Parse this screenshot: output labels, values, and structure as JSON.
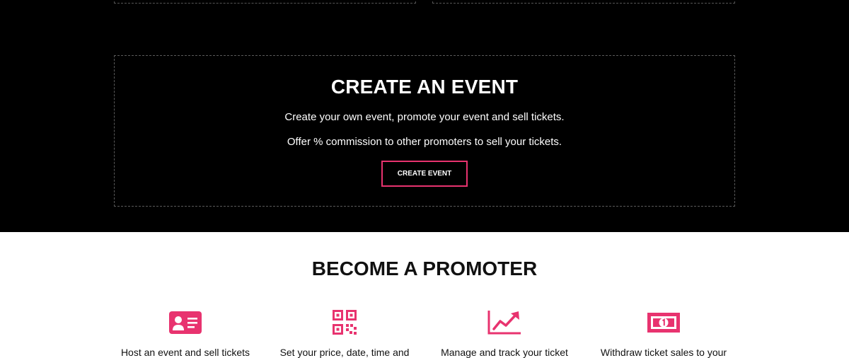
{
  "create_event": {
    "title": "CREATE AN EVENT",
    "line1": "Create your own event, promote your event and sell tickets.",
    "line2": "Offer % commission to other promoters to sell your tickets.",
    "button_label": "CREATE EVENT"
  },
  "promoter": {
    "title": "BECOME A PROMOTER",
    "features": [
      {
        "icon": "id-card-icon",
        "label": "Host an event and sell tickets"
      },
      {
        "icon": "qr-code-icon",
        "label": "Set your price, date, time and"
      },
      {
        "icon": "trending-chart-icon",
        "label": "Manage and track your ticket"
      },
      {
        "icon": "money-bill-icon",
        "label": "Withdraw ticket sales to your"
      }
    ]
  },
  "colors": {
    "accent": "#e8336f",
    "dark_background": "#000000",
    "light_background": "#ffffff"
  }
}
